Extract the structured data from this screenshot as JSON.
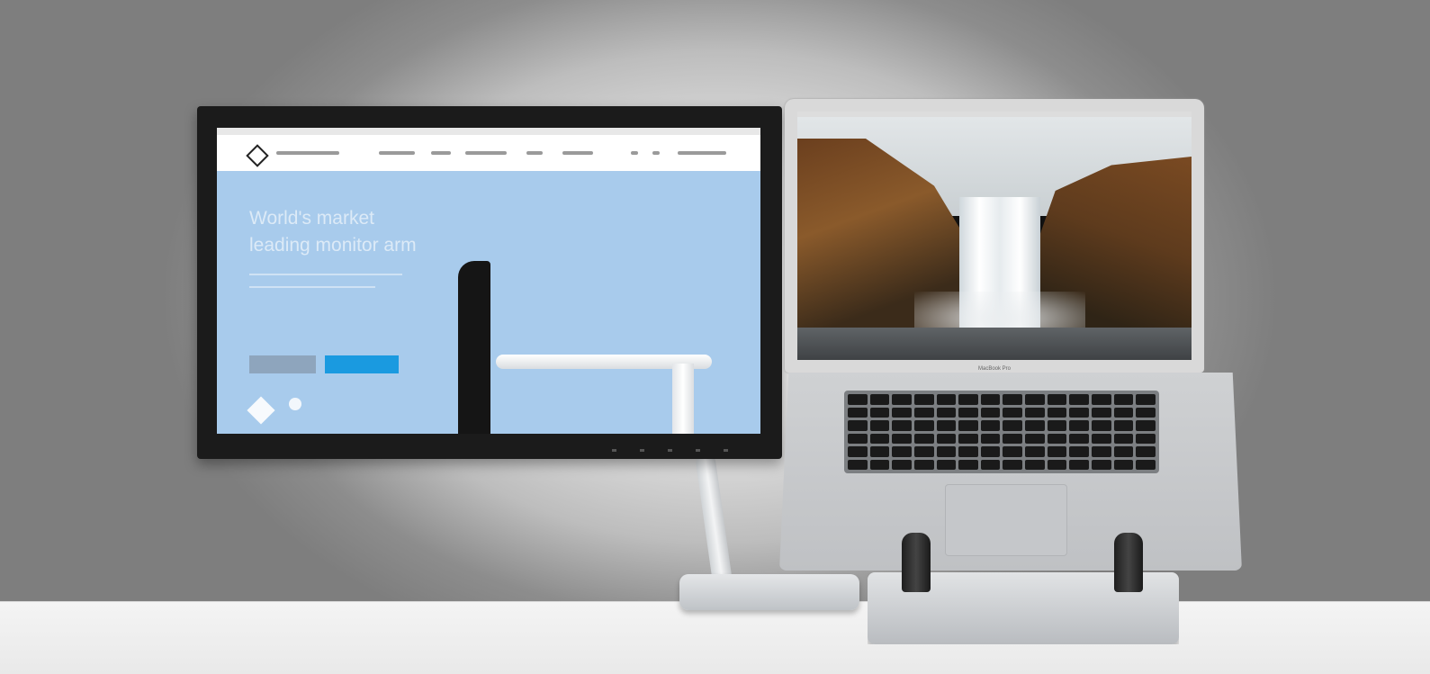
{
  "photo": {
    "website": {
      "hero_title_lines": [
        "World's market",
        "leading monitor arm"
      ],
      "accent_color": "#1a9ae0"
    },
    "laptop": {
      "bezel_label": "MacBook Pro"
    }
  },
  "colors": {
    "website_background": "#a8cbec",
    "desk": "#f0f0f0",
    "wall_center": "#f7f7f7"
  }
}
